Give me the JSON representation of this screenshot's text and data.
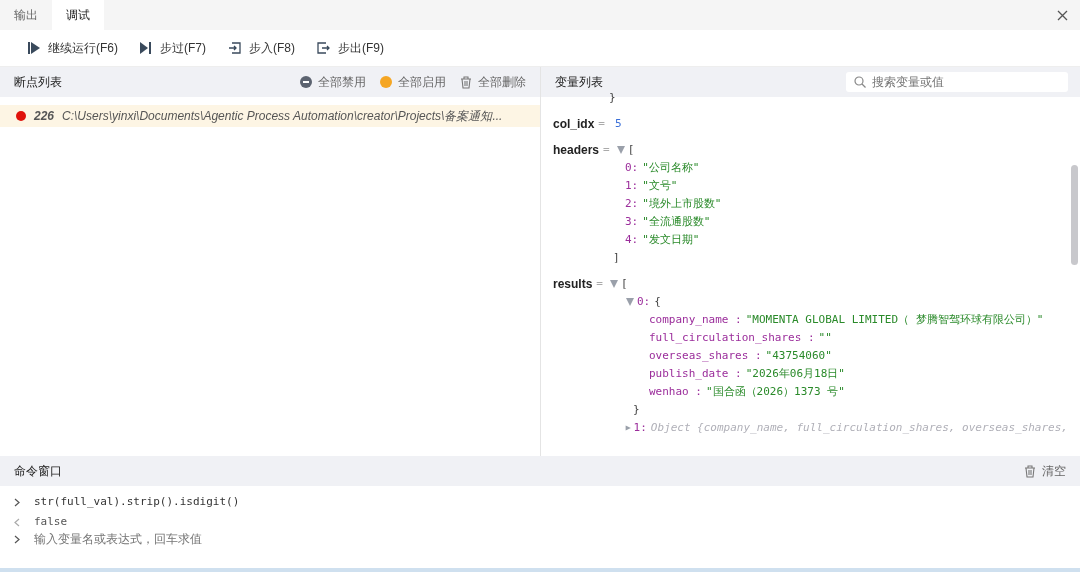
{
  "tabs": [
    {
      "label": "输出",
      "selected": false
    },
    {
      "label": "调试",
      "selected": true
    }
  ],
  "toolbar": [
    {
      "kind": "continue",
      "label": "继续运行(F6)"
    },
    {
      "kind": "step-over",
      "label": "步过(F7)"
    },
    {
      "kind": "step-into",
      "label": "步入(F8)"
    },
    {
      "kind": "step-out",
      "label": "步出(F9)"
    }
  ],
  "breakpoints_panel": {
    "title": "断点列表",
    "actions": [
      {
        "kind": "disable",
        "label": "全部禁用"
      },
      {
        "kind": "enable",
        "label": "全部启用"
      },
      {
        "kind": "delete",
        "label": "全部删除"
      }
    ],
    "items": [
      {
        "line": "226",
        "path": "C:\\Users\\yinxi\\Documents\\Agentic Process Automation\\creator\\Projects\\备案通知...",
        "enabled": true,
        "selected": true
      }
    ]
  },
  "variables_panel": {
    "title": "变量列表",
    "search": {
      "placeholder": "搜索变量或值"
    },
    "entries": [
      {
        "kind": "closing",
        "text": "}"
      },
      {
        "kind": "scalar",
        "name": "col_idx",
        "sep": "=",
        "value": "5"
      },
      {
        "kind": "array",
        "name": "headers",
        "sep": "=",
        "expanded": true,
        "open": "[",
        "close": "]",
        "items": [
          {
            "key": "0:",
            "value": "\"公司名称\""
          },
          {
            "key": "1:",
            "value": "\"文号\""
          },
          {
            "key": "2:",
            "value": "\"境外上市股数\""
          },
          {
            "key": "3:",
            "value": "\"全流通股数\""
          },
          {
            "key": "4:",
            "value": "\"发文日期\""
          }
        ]
      },
      {
        "kind": "objects",
        "name": "results",
        "sep": "=",
        "expanded": true,
        "open": "[",
        "items": [
          {
            "key": "0:",
            "expanded": true,
            "open": "{",
            "close": "}",
            "fields": [
              {
                "key": "company_name :",
                "value": "\"MOMENTA GLOBAL LIMITED（ 梦腾智驾环球有限公司）\""
              },
              {
                "key": "full_circulation_shares :",
                "value": "\"\""
              },
              {
                "key": "overseas_shares :",
                "value": "\"43754060\""
              },
              {
                "key": "publish_date :",
                "value": "\"2026年06月18日\""
              },
              {
                "key": "wenhao :",
                "value": "\"国合函（2026）1373 号\""
              }
            ]
          },
          {
            "key": "1:",
            "expanded": false,
            "summary": "Object {company_name, full_circulation_shares, overseas_shares,"
          }
        ]
      }
    ]
  },
  "command_window": {
    "title": "命令窗口",
    "clear_label": "清空",
    "lines": [
      {
        "kind": "input",
        "text": "str(full_val).strip().isdigit()"
      },
      {
        "kind": "output",
        "text": "false"
      }
    ],
    "input": {
      "placeholder": "输入变量名或表达式，回车求值"
    }
  }
}
